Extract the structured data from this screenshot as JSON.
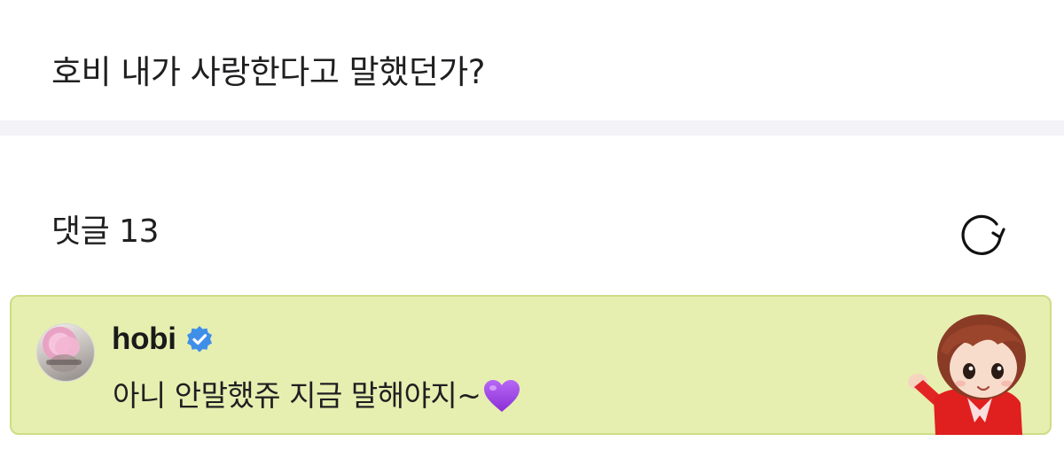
{
  "post": {
    "text": "호비 내가 사랑한다고 말했던가?"
  },
  "comments": {
    "header": "댓글 13",
    "refresh_icon": "refresh-icon"
  },
  "comment": {
    "username": "hobi",
    "verified_icon": "verified-badge-icon",
    "text": "아니 안말했쥬 지금 말해야지~",
    "emoji": "purple-heart",
    "background_color": "#e6efb0",
    "border_color": "#cfdc86",
    "sticker": "character-sticker"
  }
}
